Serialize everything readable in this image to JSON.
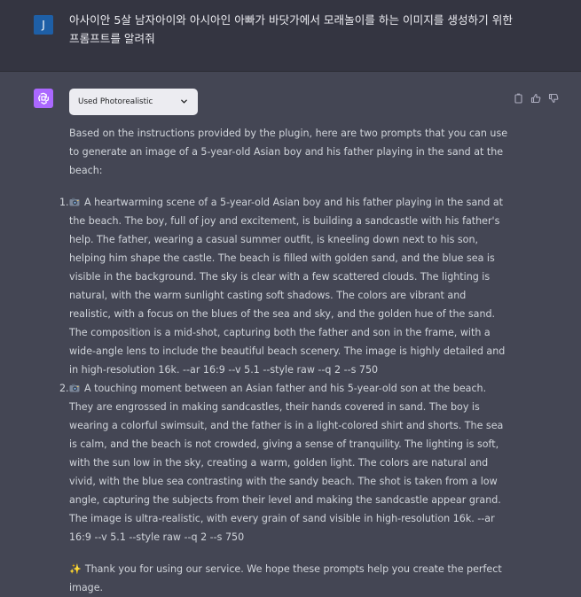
{
  "user": {
    "avatar_letter": "J",
    "message": "아사이안 5살 남자아이와 아시아인 아빠가 바닷가에서 모래놀이를 하는 이미지를 생성하기 위한 프롬프트를 알려줘"
  },
  "assistant": {
    "plugin_label": "Used Photorealistic",
    "intro": "Based on the instructions provided by the plugin, here are two prompts that you can use to generate an image of a 5-year-old Asian boy and his father playing in the sand at the beach:",
    "prompts": [
      {
        "number": "1.",
        "emoji": "camera-emoji",
        "text": "A heartwarming scene of a 5-year-old Asian boy and his father playing in the sand at the beach. The boy, full of joy and excitement, is building a sandcastle with his father's help. The father, wearing a casual summer outfit, is kneeling down next to his son, helping him shape the castle. The beach is filled with golden sand, and the blue sea is visible in the background. The sky is clear with a few scattered clouds. The lighting is natural, with the warm sunlight casting soft shadows. The colors are vibrant and realistic, with a focus on the blues of the sea and sky, and the golden hue of the sand. The composition is a mid-shot, capturing both the father and son in the frame, with a wide-angle lens to include the beautiful beach scenery. The image is highly detailed and in high-resolution 16k. --ar 16:9 --v 5.1 --style raw --q 2 --s 750"
      },
      {
        "number": "2.",
        "emoji": "camera-emoji",
        "text": "A touching moment between an Asian father and his 5-year-old son at the beach. They are engrossed in making sandcastles, their hands covered in sand. The boy is wearing a colorful swimsuit, and the father is in a light-colored shirt and shorts. The sea is calm, and the beach is not crowded, giving a sense of tranquility. The lighting is soft, with the sun low in the sky, creating a warm, golden light. The colors are natural and vivid, with the blue sea contrasting with the sandy beach. The shot is taken from a low angle, capturing the subjects from their level and making the sandcastle appear grand. The image is ultra-realistic, with every grain of sand visible in high-resolution 16k. --ar 16:9 --v 5.1 --style raw --q 2 --s 750"
      }
    ],
    "outro_emoji": "✨",
    "outro": "Thank you for using our service. We hope these prompts help you create the perfect image."
  },
  "colors": {
    "user_bg": "#343541",
    "assistant_bg": "#444654",
    "user_avatar": "#1e5fa6",
    "assistant_avatar": "#ab68ff",
    "text": "#d1d5db"
  },
  "icons": [
    "openai-logo-icon",
    "chevron-down-icon",
    "copy-icon",
    "thumbs-up-icon",
    "thumbs-down-icon"
  ]
}
